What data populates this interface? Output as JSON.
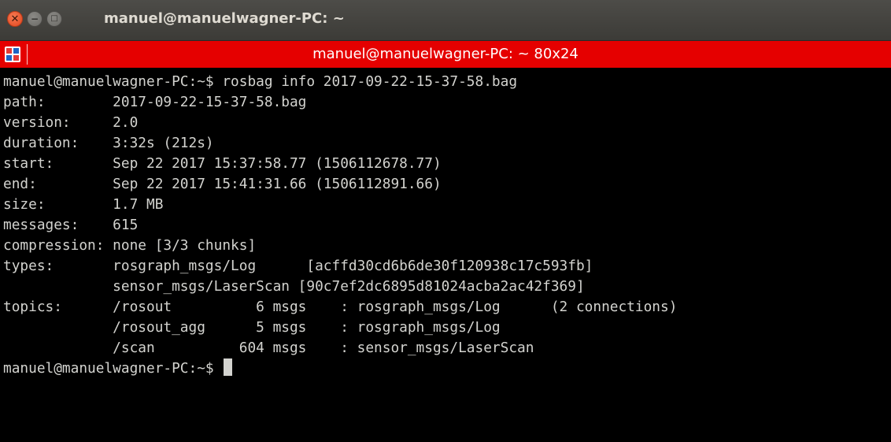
{
  "window": {
    "title": "manuel@manuelwagner-PC: ~",
    "controls": {
      "close_icon": "close-icon",
      "minimize_icon": "minimize-icon",
      "maximize_icon": "maximize-icon"
    }
  },
  "tab": {
    "icon": "terminal-icon",
    "title": "manuel@manuelwagner-PC: ~ 80x24"
  },
  "terminal": {
    "lines": [
      "manuel@manuelwagner-PC:~$ rosbag info 2017-09-22-15-37-58.bag",
      "path:        2017-09-22-15-37-58.bag",
      "version:     2.0",
      "duration:    3:32s (212s)",
      "start:       Sep 22 2017 15:37:58.77 (1506112678.77)",
      "end:         Sep 22 2017 15:41:31.66 (1506112891.66)",
      "size:        1.7 MB",
      "messages:    615",
      "compression: none [3/3 chunks]",
      "types:       rosgraph_msgs/Log      [acffd30cd6b6de30f120938c17c593fb]",
      "             sensor_msgs/LaserScan [90c7ef2dc6895d81024acba2ac42f369]",
      "topics:      /rosout          6 msgs    : rosgraph_msgs/Log      (2 connections)",
      "             /rosout_agg      5 msgs    : rosgraph_msgs/Log",
      "             /scan          604 msgs    : sensor_msgs/LaserScan"
    ],
    "prompt": "manuel@manuelwagner-PC:~$ "
  },
  "colors": {
    "tab_bar": "#e50000",
    "close_button": "#e0461f",
    "terminal_bg": "#000000",
    "terminal_text": "#d3d3cf"
  }
}
